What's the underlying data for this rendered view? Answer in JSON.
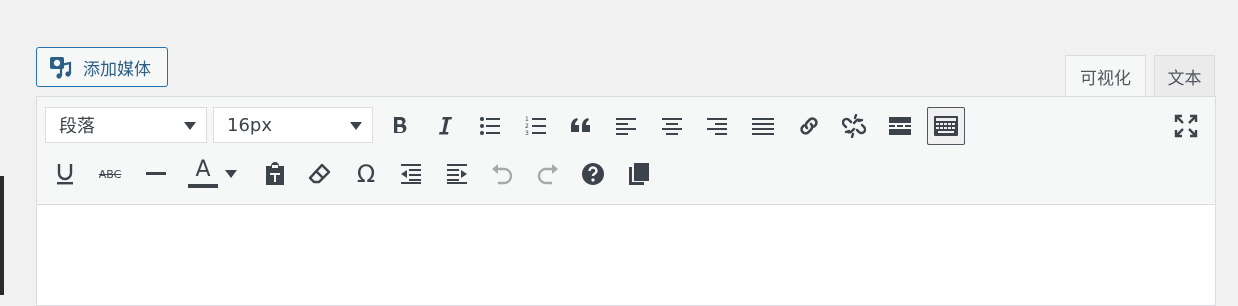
{
  "media_button": {
    "label": "添加媒体",
    "icon": "add-media-icon"
  },
  "tabs": [
    {
      "label": "可视化",
      "active": true
    },
    {
      "label": "文本",
      "active": false
    }
  ],
  "toolbar": {
    "format_select": {
      "value": "段落"
    },
    "font_size_select": {
      "value": "16px"
    },
    "row1": [
      "bold",
      "italic",
      "bullet-list",
      "numbered-list",
      "blockquote",
      "align-left",
      "align-center",
      "align-right",
      "justify",
      "insert-link",
      "remove-link",
      "read-more",
      "toolbar-toggle",
      "fullscreen"
    ],
    "row2": [
      "underline",
      "strikethrough",
      "horizontal-line",
      "text-color",
      "paste-as-text",
      "clear-formatting",
      "special-character",
      "outdent",
      "indent",
      "undo",
      "redo",
      "help",
      "copy"
    ],
    "strikethrough_text": "ABC",
    "text_color_letter": "A",
    "omega": "Ω",
    "text_color_swatch": "#3c434a"
  },
  "colors": {
    "accent": "#2271b1",
    "icon": "#3c434a",
    "disabled": "#a7aaad"
  }
}
